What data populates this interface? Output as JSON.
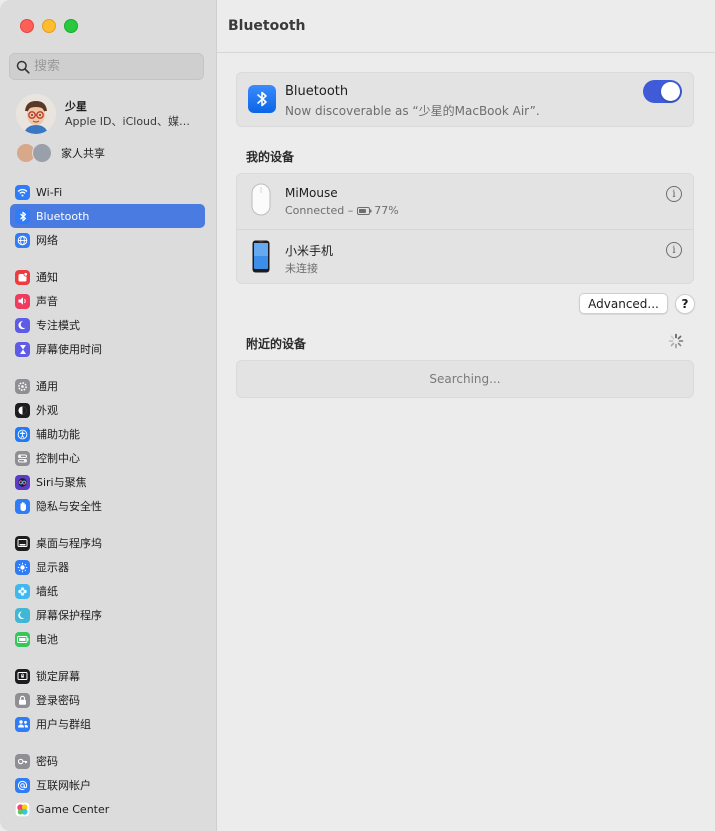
{
  "window": {
    "title": "Bluetooth"
  },
  "sidebar": {
    "search_placeholder": "搜索",
    "profile": {
      "name": "少星",
      "subtitle": "Apple ID、iCloud、媒体与 App Store"
    },
    "family_label": "家人共享",
    "groups": [
      [
        {
          "label": "Wi-Fi",
          "icon": "wifi-icon",
          "color": "#2f7cf6",
          "glyph": "wifi"
        },
        {
          "label": "Bluetooth",
          "icon": "bluetooth-icon",
          "color": "#2f7cf6",
          "glyph": "bt",
          "active": true
        },
        {
          "label": "网络",
          "icon": "globe-icon",
          "color": "#2f7cf6",
          "glyph": "globe"
        }
      ],
      [
        {
          "label": "通知",
          "icon": "bell-icon",
          "color": "#f03a3f",
          "glyph": "notif"
        },
        {
          "label": "声音",
          "icon": "speaker-icon",
          "color": "#f03a5f",
          "glyph": "sound"
        },
        {
          "label": "专注模式",
          "icon": "moon-icon",
          "color": "#5e5ce6",
          "glyph": "moon"
        },
        {
          "label": "屏幕使用时间",
          "icon": "hourglass-icon",
          "color": "#5e5ce6",
          "glyph": "hourglass"
        }
      ],
      [
        {
          "label": "通用",
          "icon": "gear-icon",
          "color": "#8e8e93",
          "glyph": "gear"
        },
        {
          "label": "外观",
          "icon": "appearance-icon",
          "color": "#1d1d1f",
          "glyph": "appearance"
        },
        {
          "label": "辅助功能",
          "icon": "accessibility-icon",
          "color": "#1f7cf5",
          "glyph": "access"
        },
        {
          "label": "控制中心",
          "icon": "control-center-icon",
          "color": "#8e8e93",
          "glyph": "control"
        },
        {
          "label": "Siri与聚焦",
          "icon": "siri-icon",
          "color": "#5b3ec8",
          "glyph": "siri"
        },
        {
          "label": "隐私与安全性",
          "icon": "hand-icon",
          "color": "#2f7cf6",
          "glyph": "hand"
        }
      ],
      [
        {
          "label": "桌面与程序坞",
          "icon": "dock-icon",
          "color": "#1d1d1f",
          "glyph": "dock"
        },
        {
          "label": "显示器",
          "icon": "sun-icon",
          "color": "#2f7cf6",
          "glyph": "sun"
        },
        {
          "label": "墙纸",
          "icon": "wallpaper-icon",
          "color": "#3fb8f0",
          "glyph": "flower"
        },
        {
          "label": "屏幕保护程序",
          "icon": "screensaver-icon",
          "color": "#3fb8d8",
          "glyph": "screensaver"
        },
        {
          "label": "电池",
          "icon": "battery-icon",
          "color": "#34c759",
          "glyph": "battery"
        }
      ],
      [
        {
          "label": "锁定屏幕",
          "icon": "lock-screen-icon",
          "color": "#1d1d1f",
          "glyph": "lockscreen"
        },
        {
          "label": "登录密码",
          "icon": "lock-icon",
          "color": "#8e8e93",
          "glyph": "lock"
        },
        {
          "label": "用户与群组",
          "icon": "users-icon",
          "color": "#2f7cf6",
          "glyph": "users"
        }
      ],
      [
        {
          "label": "密码",
          "icon": "key-icon",
          "color": "#8e8e93",
          "glyph": "key"
        },
        {
          "label": "互联网帐户",
          "icon": "at-icon",
          "color": "#2f7cf6",
          "glyph": "at"
        },
        {
          "label": "Game Center",
          "icon": "game-center-icon",
          "color": "#ffffff",
          "glyph": "game"
        }
      ]
    ]
  },
  "bluetooth": {
    "title": "Bluetooth",
    "subtitle": "Now discoverable as “少星的MacBook Air”.",
    "enabled": true
  },
  "my_devices": {
    "heading": "我的设备",
    "devices": [
      {
        "name": "MiMouse",
        "status_prefix": "Connected –",
        "battery": "77%",
        "battery_level": 0.77,
        "icon": "mouse-icon"
      },
      {
        "name": "小米手机",
        "status_prefix": "未连接",
        "battery": "",
        "icon": "phone-icon"
      }
    ],
    "info_glyph": "i"
  },
  "actions": {
    "advanced_label": "Advanced...",
    "help_label": "?"
  },
  "nearby": {
    "heading": "附近的设备",
    "searching_text": "Searching..."
  }
}
